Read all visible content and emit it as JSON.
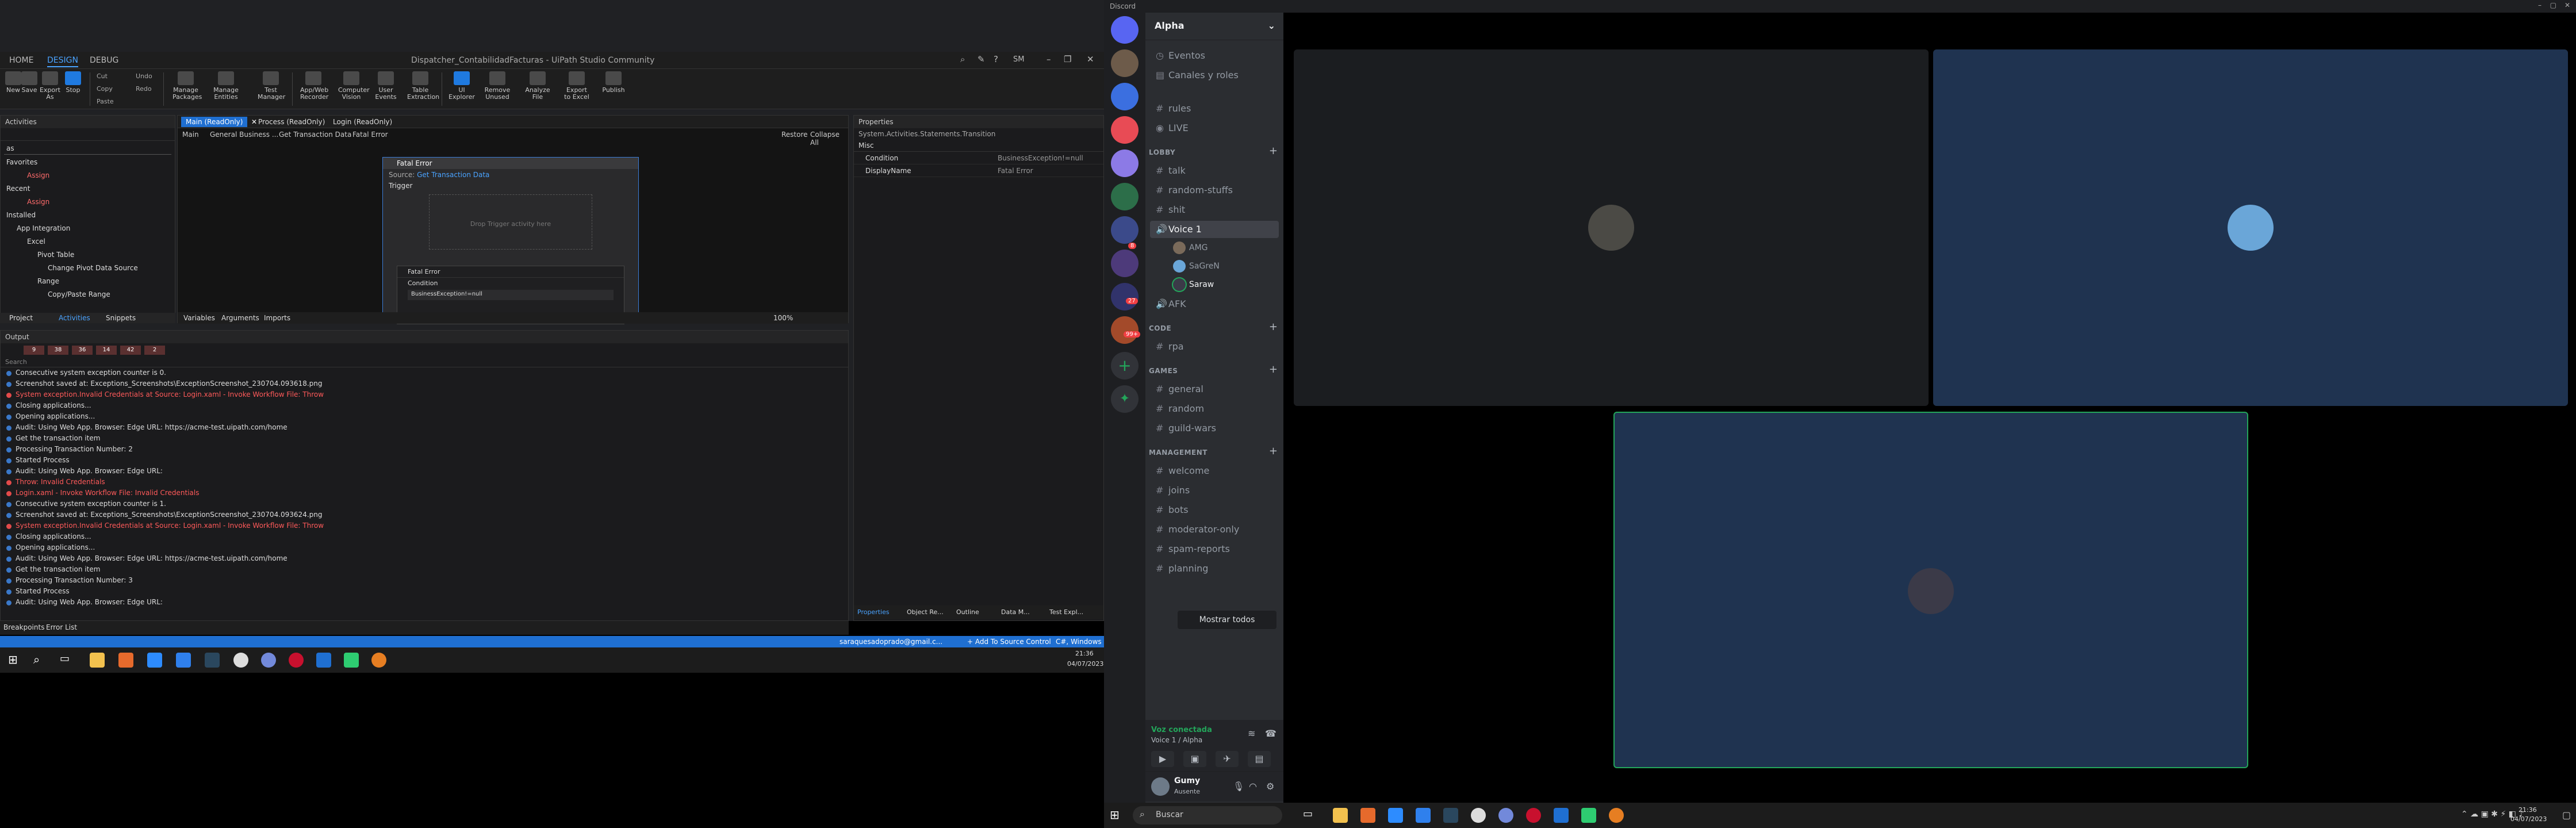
{
  "uipath": {
    "ribbon_tabs": [
      "HOME",
      "DESIGN",
      "DEBUG"
    ],
    "window_title": "Dispatcher_ContabilidadFacturas - UiPath Studio Community",
    "user_badge": "SM",
    "ribbon": {
      "new": "New",
      "save": "Save",
      "export": "Export As",
      "stop": "Stop",
      "cut": "Cut",
      "copy": "Copy",
      "paste": "Paste",
      "undo": "Undo",
      "redo": "Redo",
      "manage_packages": "Manage Packages",
      "manage_entities": "Manage Entities",
      "test_manager": "Test Manager",
      "app_web_recorder": "App/Web Recorder",
      "computer_vision": "Computer Vision",
      "user_events": "User Events",
      "table_extraction": "Table Extraction",
      "ui_explorer": "UI Explorer",
      "remove_unused": "Remove Unused",
      "analyze_file": "Analyze File",
      "export_excel": "Export to Excel",
      "publish": "Publish"
    },
    "activities": {
      "title": "Activities",
      "search": "as",
      "tree": [
        {
          "label": "Favorites",
          "indent": 0
        },
        {
          "label": "Assign",
          "indent": 2,
          "red": true
        },
        {
          "label": "Recent",
          "indent": 0
        },
        {
          "label": "Assign",
          "indent": 2,
          "red": true
        },
        {
          "label": "Installed",
          "indent": 0
        },
        {
          "label": "App Integration",
          "indent": 1
        },
        {
          "label": "Excel",
          "indent": 2
        },
        {
          "label": "Pivot Table",
          "indent": 3
        },
        {
          "label": "Change Pivot Data Source",
          "indent": 4
        },
        {
          "label": "Range",
          "indent": 3
        },
        {
          "label": "Copy/Paste Range",
          "indent": 4
        }
      ],
      "bottom_tabs": [
        "Project",
        "Activities",
        "Snippets"
      ]
    },
    "designer": {
      "tabs": [
        "Main (ReadOnly)",
        "Process (ReadOnly)",
        "Login (ReadOnly)"
      ],
      "breadcrumb": [
        "Main",
        "General Business ...",
        "Get Transaction Data",
        "Fatal Error"
      ],
      "restore": "Restore",
      "collapse_all": "Collapse All",
      "card_title": "Fatal Error",
      "source_label": "Source:",
      "source_value": "Get Transaction Data",
      "trigger": "Trigger",
      "drop_hint": "Drop Trigger activity here",
      "inner_title": "Fatal Error",
      "condition_label": "Condition",
      "condition_value": "BusinessException!=null",
      "bottom_tabs": [
        "Variables",
        "Arguments",
        "Imports"
      ],
      "zoom": "100%"
    },
    "properties": {
      "title": "Properties",
      "type": "System.Activities.Statements.Transition",
      "section": "Misc",
      "rows": [
        {
          "k": "Condition",
          "v": "BusinessException!=null"
        },
        {
          "k": "DisplayName",
          "v": "Fatal Error"
        }
      ],
      "bottom_tabs": [
        "Properties",
        "Object Re...",
        "Outline",
        "Data M...",
        "Test Expl..."
      ]
    },
    "output": {
      "title": "Output",
      "counts": [
        "9",
        "38",
        "36",
        "14",
        "42",
        "2"
      ],
      "search": "Search",
      "lines": [
        {
          "t": "Consecutive system exception counter is 0.",
          "err": false
        },
        {
          "t": "Screenshot saved at: Exceptions_Screenshots\\ExceptionScreenshot_230704.093618.png",
          "err": false
        },
        {
          "t": "System exception.Invalid Credentials at Source: Login.xaml - Invoke Workflow File: Throw",
          "err": true
        },
        {
          "t": "Closing applications...",
          "err": false
        },
        {
          "t": "Opening applications...",
          "err": false
        },
        {
          "t": "Audit: Using Web App. Browser: Edge URL: https://acme-test.uipath.com/home",
          "err": false
        },
        {
          "t": "Get the transaction item",
          "err": false
        },
        {
          "t": "Processing Transaction Number: 2",
          "err": false
        },
        {
          "t": "Started Process",
          "err": false
        },
        {
          "t": "Audit: Using Web App. Browser: Edge URL:",
          "err": false
        },
        {
          "t": "Throw: Invalid Credentials",
          "err": true
        },
        {
          "t": "Login.xaml - Invoke Workflow File: Invalid Credentials",
          "err": true
        },
        {
          "t": "Consecutive system exception counter is 1.",
          "err": false
        },
        {
          "t": "Screenshot saved at: Exceptions_Screenshots\\ExceptionScreenshot_230704.093624.png",
          "err": false
        },
        {
          "t": "System exception.Invalid Credentials at Source: Login.xaml - Invoke Workflow File: Throw",
          "err": true
        },
        {
          "t": "Closing applications...",
          "err": false
        },
        {
          "t": "Opening applications...",
          "err": false
        },
        {
          "t": "Audit: Using Web App. Browser: Edge URL: https://acme-test.uipath.com/home",
          "err": false
        },
        {
          "t": "Get the transaction item",
          "err": false
        },
        {
          "t": "Processing Transaction Number: 3",
          "err": false
        },
        {
          "t": "Started Process",
          "err": false
        },
        {
          "t": "Audit: Using Web App. Browser: Edge URL:",
          "err": false
        }
      ],
      "bottom_tabs": [
        "Breakpoints",
        "Error List"
      ]
    },
    "statusbar": {
      "email": "saraquesadoprado@gmail.c...",
      "source_control": "+ Add To Source Control",
      "lang": "C#, Windows"
    }
  },
  "taskbar_left": {
    "time": "21:36",
    "date": "04/07/2023"
  },
  "discord": {
    "app_title": "Discord",
    "server_name": "Alpha",
    "channels_top": [
      {
        "icon": "◷",
        "label": "Eventos"
      },
      {
        "icon": "▤",
        "label": "Canales y roles"
      }
    ],
    "channels_mid": [
      {
        "icon": "#",
        "label": "rules"
      },
      {
        "icon": "◉",
        "label": "LIVE"
      }
    ],
    "cat_lobby": "LOBBY",
    "lobby": [
      {
        "label": "talk"
      },
      {
        "label": "random-stuffs"
      },
      {
        "label": "shit"
      }
    ],
    "voice_channel": "Voice 1",
    "voice_members": [
      "AMG",
      "SaGreN",
      "Saraw"
    ],
    "afk": "AFK",
    "cat_code": "CODE",
    "code": [
      {
        "label": "rpa"
      }
    ],
    "cat_games": "GAMES",
    "games": [
      {
        "label": "general"
      },
      {
        "label": "random"
      },
      {
        "label": "guild-wars"
      }
    ],
    "cat_management": "MANAGEMENT",
    "management": [
      {
        "label": "welcome"
      },
      {
        "label": "joins"
      },
      {
        "label": "bots"
      },
      {
        "label": "moderator-only"
      },
      {
        "label": "spam-reports"
      },
      {
        "label": "planning"
      }
    ],
    "show_all": "Mostrar todos",
    "voice_status": "Voz conectada",
    "voice_sub": "Voice 1 / Alpha",
    "user_name": "Gumy",
    "user_status": "Ausente",
    "server_badges": [
      "8",
      "27",
      "99+"
    ]
  },
  "taskbar_right": {
    "search": "Buscar",
    "time": "21:36",
    "date": "04/07/2023"
  },
  "colors": {
    "accent": "#1f6fd1",
    "discord_bg": "#2b2d31",
    "tile_blue": "#1f3350",
    "tile_dark": "#1b1d20",
    "speaking": "#23a55a"
  }
}
